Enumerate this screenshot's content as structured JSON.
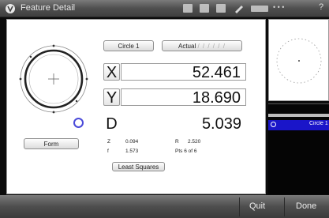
{
  "window": {
    "title": "Feature Detail"
  },
  "toolbar": {
    "help": "?"
  },
  "feature": {
    "name_button": "Circle 1",
    "actual_button": "Actual",
    "actual_faded": "/ / / / / /",
    "form_button": "Form",
    "least_squares_button": "Least Squares"
  },
  "measurements": {
    "x_label": "X",
    "x_value": "52.461",
    "y_label": "Y",
    "y_value": "18.690",
    "d_label": "D",
    "d_value": "5.039"
  },
  "details": {
    "z_label": "Z",
    "z_value": "0.094",
    "r_label": "R",
    "r_value": "2.520",
    "f_label": "f",
    "f_value": "1.573",
    "pts_label": "Pts 6 of 6"
  },
  "feature_list": {
    "selected_item": "Circle 1"
  },
  "bottom": {
    "quit": "Quit",
    "done": "Done"
  },
  "colors": {
    "selection": "#1a15c9",
    "marker": "#4a4ad9"
  }
}
